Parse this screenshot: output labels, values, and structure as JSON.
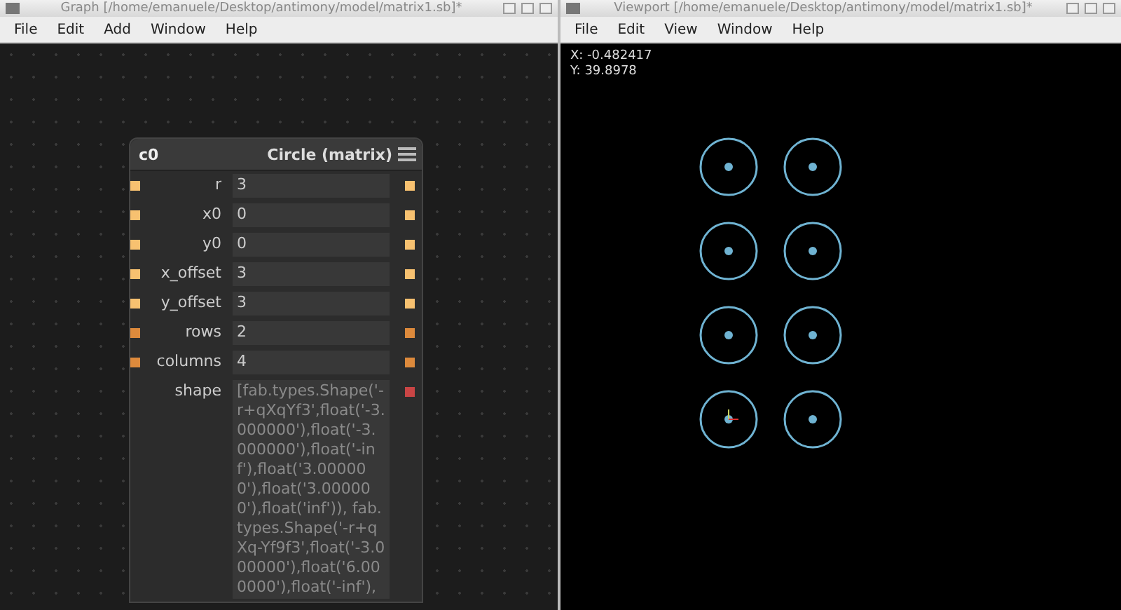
{
  "graph_window": {
    "title": "Graph [/home/emanuele/Desktop/antimony/model/matrix1.sb]*",
    "menu": [
      "File",
      "Edit",
      "Add",
      "Window",
      "Help"
    ],
    "node": {
      "name": "c0",
      "type": "Circle (matrix)",
      "inputs": [
        {
          "label": "r",
          "value": "3",
          "kind": "number",
          "color": "#f7c170"
        },
        {
          "label": "x0",
          "value": "0",
          "kind": "number",
          "color": "#f7c170"
        },
        {
          "label": "y0",
          "value": "0",
          "kind": "number",
          "color": "#f7c170"
        },
        {
          "label": "x_offset",
          "value": "3",
          "kind": "number",
          "color": "#f7c170"
        },
        {
          "label": "y_offset",
          "value": "3",
          "kind": "number",
          "color": "#f7c170"
        },
        {
          "label": "rows",
          "value": "2",
          "kind": "number",
          "color": "#dd8a3c"
        },
        {
          "label": "columns",
          "value": "4",
          "kind": "number",
          "color": "#dd8a3c"
        },
        {
          "label": "shape",
          "value": "[fab.types.Shape('-r+qXqYf3',float('-3.000000'),float('-3.000000'),float('-inf'),float('3.000000'),float('3.000000'),float('inf')), fab.types.Shape('-r+qXq-Yf9f3',float('-3.000000'),float('6.000000'),float('-inf'),",
          "kind": "shape",
          "color": "#c94545"
        }
      ]
    }
  },
  "viewport_window": {
    "title": "Viewport [/home/emanuele/Desktop/antimony/model/matrix1.sb]*",
    "menu": [
      "File",
      "Edit",
      "View",
      "Window",
      "Help"
    ],
    "x_readout": "X: -0.482417",
    "y_readout": "Y: 39.8978"
  }
}
